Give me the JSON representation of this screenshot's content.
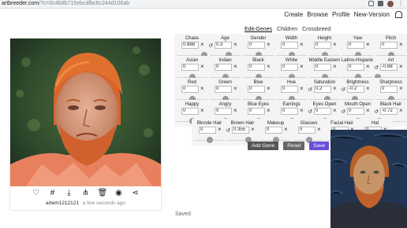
{
  "browser": {
    "url_host": "artbreeder.com",
    "url_path": "/?c=0c4b8b715ebcdfbc6c244d106ab"
  },
  "nav": {
    "links": [
      "Create",
      "Browse",
      "Profile",
      "New-Version"
    ]
  },
  "portrait": {
    "author": "artem1212121",
    "time": "a few seconds ago",
    "actions": [
      "heart-icon",
      "hash-icon",
      "download-icon",
      "tree-icon",
      "trash-icon",
      "eye-icon",
      "share-icon"
    ]
  },
  "tabs": [
    "Edit-Genes",
    "Children",
    "Crossbreed"
  ],
  "genes": [
    {
      "label": "Chaos",
      "value": "0.888",
      "level": 0.9,
      "reset": false
    },
    {
      "label": "Age",
      "value": "0.3",
      "level": 0.62,
      "reset": true
    },
    {
      "label": "Gender",
      "value": "0",
      "level": 0.5,
      "reset": false
    },
    {
      "label": "Width",
      "value": "0",
      "level": 0.5,
      "reset": false
    },
    {
      "label": "Height",
      "value": "0",
      "level": 0.5,
      "reset": false
    },
    {
      "label": "Yaw",
      "value": "0",
      "level": 0.5,
      "reset": false
    },
    {
      "label": "Pitch",
      "value": "0",
      "level": 0.5,
      "reset": false
    },
    {
      "label": "Asian",
      "value": "0",
      "level": 0.5,
      "reset": false
    },
    {
      "label": "Indian",
      "value": "0",
      "level": 0.5,
      "reset": false
    },
    {
      "label": "Black",
      "value": "0",
      "level": 0.5,
      "reset": false
    },
    {
      "label": "White",
      "value": "0",
      "level": 0.5,
      "reset": false
    },
    {
      "label": "Middle Eastern",
      "value": "0",
      "level": 0.5,
      "reset": false
    },
    {
      "label": "Latino-Hispanic",
      "value": "0",
      "level": 0.5,
      "reset": false
    },
    {
      "label": "Art",
      "value": "-0.88",
      "level": 0.08,
      "reset": true
    },
    {
      "label": "Red",
      "value": "0",
      "level": 0.5,
      "reset": false
    },
    {
      "label": "Green",
      "value": "0",
      "level": 0.5,
      "reset": false
    },
    {
      "label": "Blue",
      "value": "0",
      "level": 0.5,
      "reset": false
    },
    {
      "label": "Hue",
      "value": "0",
      "level": 0.5,
      "reset": false
    },
    {
      "label": "Saturation",
      "value": "0.2",
      "level": 0.6,
      "reset": true
    },
    {
      "label": "Brightness",
      "value": "-0.2",
      "level": 0.4,
      "reset": true
    },
    {
      "label": "Sharpness",
      "value": "0",
      "level": 0.5,
      "reset": false
    },
    {
      "label": "Happy",
      "value": "0",
      "level": 0.5,
      "reset": false
    },
    {
      "label": "Angry",
      "value": "0",
      "level": 0.5,
      "reset": false
    },
    {
      "label": "Blue Eyes",
      "value": "0",
      "level": 0.5,
      "reset": false
    },
    {
      "label": "Earrings",
      "value": "0",
      "level": 0.5,
      "reset": false
    },
    {
      "label": "Eyes Open",
      "value": "0",
      "level": 0.5,
      "reset": true
    },
    {
      "label": "Mouth Open",
      "value": "0",
      "level": 0.5,
      "reset": true
    },
    {
      "label": "Black Hair",
      "value": "-0.72",
      "level": 0.14,
      "reset": true
    },
    {
      "label": "Blonde Hair",
      "value": "0",
      "level": 0.5,
      "reset": false
    },
    {
      "label": "Brown Hair",
      "value": "0.355",
      "level": 0.68,
      "reset": true
    },
    {
      "label": "Makeup",
      "value": "0",
      "level": 0.5,
      "reset": false
    },
    {
      "label": "Glasses",
      "value": "0",
      "level": 0.5,
      "reset": false
    },
    {
      "label": "Facial Hair",
      "value": "0",
      "level": 0.5,
      "reset": false
    },
    {
      "label": "Hat",
      "value": "0",
      "level": 0.5,
      "reset": false
    }
  ],
  "buttons": {
    "add_gene": "Add Gene",
    "reset": "Reset",
    "save": "Save"
  },
  "status": "Saved",
  "colors": {
    "save_button": "#6c4ed6",
    "hair": "#d8642a"
  }
}
